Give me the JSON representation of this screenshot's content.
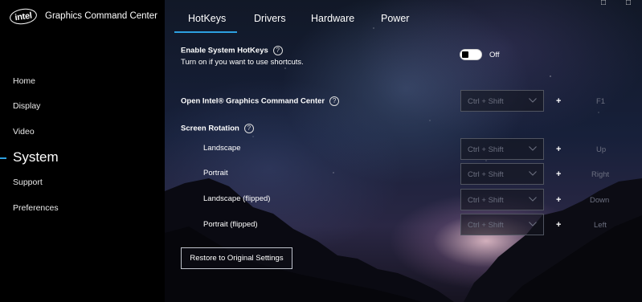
{
  "app": {
    "logo_text": "intel",
    "title": "Graphics Command Center",
    "window_controls": [
      "□",
      "□"
    ]
  },
  "sidebar": {
    "items": [
      {
        "label": "Home"
      },
      {
        "label": "Display"
      },
      {
        "label": "Video"
      },
      {
        "label": "System",
        "active": true
      },
      {
        "label": "Support"
      },
      {
        "label": "Preferences"
      }
    ],
    "accent": "#2da0e0"
  },
  "tabs": [
    {
      "label": "HotKeys",
      "active": true
    },
    {
      "label": "Drivers"
    },
    {
      "label": "Hardware"
    },
    {
      "label": "Power"
    }
  ],
  "hotkeys": {
    "enable_title": "Enable System HotKeys",
    "enable_desc": "Turn on if you want to use shortcuts.",
    "toggle_state": "Off",
    "help_glyph": "?",
    "open_gcc_label": "Open Intel® Graphics Command Center",
    "open_gcc_modifier": "Ctrl + Shift",
    "open_gcc_key": "F1",
    "plus": "+",
    "rotation_title": "Screen Rotation",
    "rotations": [
      {
        "label": "Landscape",
        "modifier": "Ctrl + Shift",
        "key": "Up"
      },
      {
        "label": "Portrait",
        "modifier": "Ctrl + Shift",
        "key": "Right"
      },
      {
        "label": "Landscape (flipped)",
        "modifier": "Ctrl + Shift",
        "key": "Down"
      },
      {
        "label": "Portrait (flipped)",
        "modifier": "Ctrl + Shift",
        "key": "Left"
      }
    ],
    "restore_label": "Restore to Original Settings"
  }
}
